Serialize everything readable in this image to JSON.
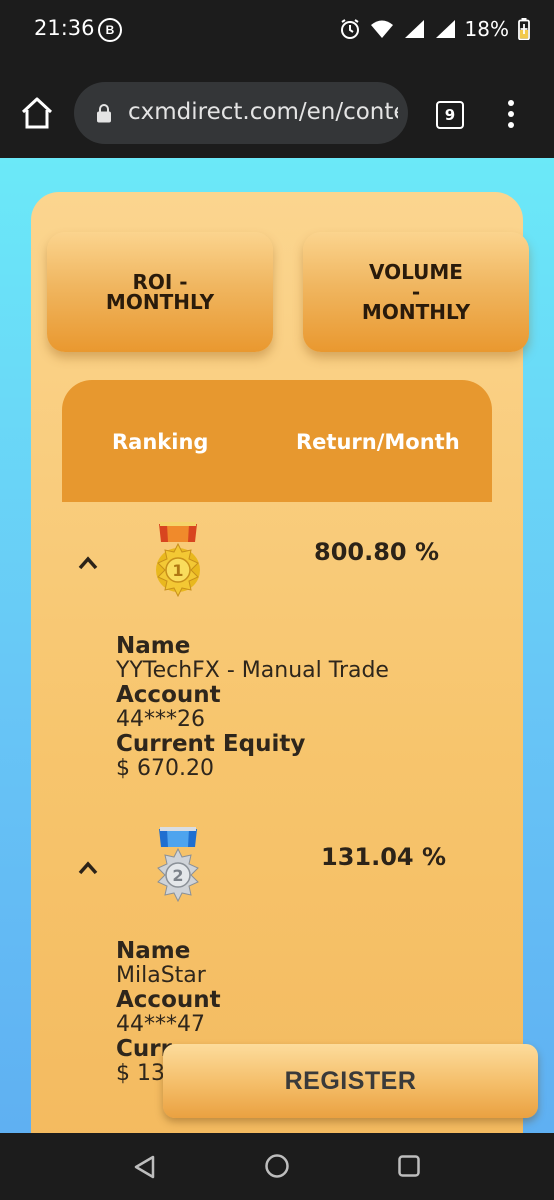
{
  "status_bar": {
    "time": "21:36",
    "notification_badge": "B",
    "battery_percent": "18%"
  },
  "browser": {
    "url": "cxmdirect.com/en/conte",
    "tab_count": "9"
  },
  "tabs": {
    "roi_label": "ROI -\nMONTHLY",
    "volume_label": "VOLUME\n-\nMONTHLY"
  },
  "table": {
    "col_ranking": "Ranking",
    "col_return": "Return/Month"
  },
  "entries": [
    {
      "rank": 1,
      "medal": "gold-medal-1",
      "return": "800.80 %",
      "name_label": "Name",
      "name": "YYTechFX - Manual Trade",
      "account_label": "Account",
      "account": "44***26",
      "equity_label": "Current Equity",
      "equity": "$ 670.20"
    },
    {
      "rank": 2,
      "medal": "silver-medal-2",
      "return": "131.04 %",
      "name_label": "Name",
      "name": "MilaStar",
      "account_label": "Account",
      "account": "44***47",
      "equity_label": "Curr",
      "equity": "$ 13"
    }
  ],
  "register_label": "REGISTER",
  "colors": {
    "page_background": "#6fd3f5",
    "card": "#f7c56d",
    "header": "#e7982f",
    "system_bar": "#1c1c1c"
  }
}
